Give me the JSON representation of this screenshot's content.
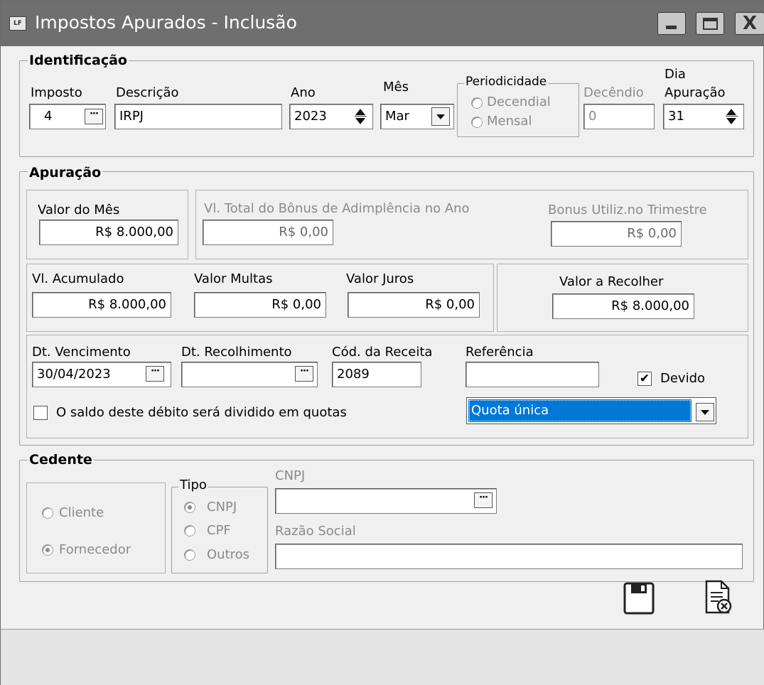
{
  "window": {
    "title": "Impostos Apurados  - Inclusão",
    "app_icon_text": "LF"
  },
  "identificacao": {
    "legend": "Identificação",
    "imposto_label": "Imposto",
    "imposto_value": "4",
    "descricao_label": "Descrição",
    "descricao_value": "IRPJ",
    "ano_label": "Ano",
    "ano_value": "2023",
    "mes_label": "Mês",
    "mes_value": "Mar",
    "periodicidade_legend": "Periodicidade",
    "periodicidade_options": [
      "Decendial",
      "Mensal"
    ],
    "decendio_label": "Decêndio",
    "decendio_value": "0",
    "dia_label_1": "Dia",
    "dia_label_2": "Apuração",
    "dia_value": "31"
  },
  "apuracao": {
    "legend": "Apuração",
    "valor_mes_label": "Valor do Mês",
    "valor_mes_value": "R$ 8.000,00",
    "bonus_total_label": "Vl. Total do Bônus de Adimplência no Ano",
    "bonus_total_value": "R$ 0,00",
    "bonus_utiliz_label": "Bonus Utiliz.no Trimestre",
    "bonus_utiliz_value": "R$ 0,00",
    "acumulado_label": "Vl. Acumulado",
    "acumulado_value": "R$ 8.000,00",
    "multas_label": "Valor Multas",
    "multas_value": "R$ 0,00",
    "juros_label": "Valor Juros",
    "juros_value": "R$ 0,00",
    "recolher_label": "Valor a Recolher",
    "recolher_value": "R$ 8.000,00",
    "vencimento_label": "Dt. Vencimento",
    "vencimento_value": "30/04/2023",
    "recolhimento_label": "Dt. Recolhimento",
    "recolhimento_value": "",
    "receita_label": "Cód. da Receita",
    "receita_value": "2089",
    "referencia_label": "Referência",
    "referencia_value": "",
    "devido_label": "Devido",
    "devido_checked": true,
    "quotas_label": "O saldo deste débito será dividido em quotas",
    "quotas_checked": false,
    "quota_select_value": "Quota única"
  },
  "cedente": {
    "legend": "Cedente",
    "cliente_label": "Cliente",
    "fornecedor_label": "Fornecedor",
    "tipo_legend": "Tipo",
    "tipo_options": [
      "CNPJ",
      "CPF",
      "Outros"
    ],
    "cnpj_label": "CNPJ",
    "cnpj_value": "",
    "razao_label": "Razão Social",
    "razao_value": ""
  },
  "colors": {
    "titlebar": "#6f6f6f",
    "selection": "#0078d7",
    "disabled_text": "#8a8a8a"
  },
  "icons": {
    "save": "floppy-disk-icon",
    "cancel": "document-cancel-icon"
  }
}
